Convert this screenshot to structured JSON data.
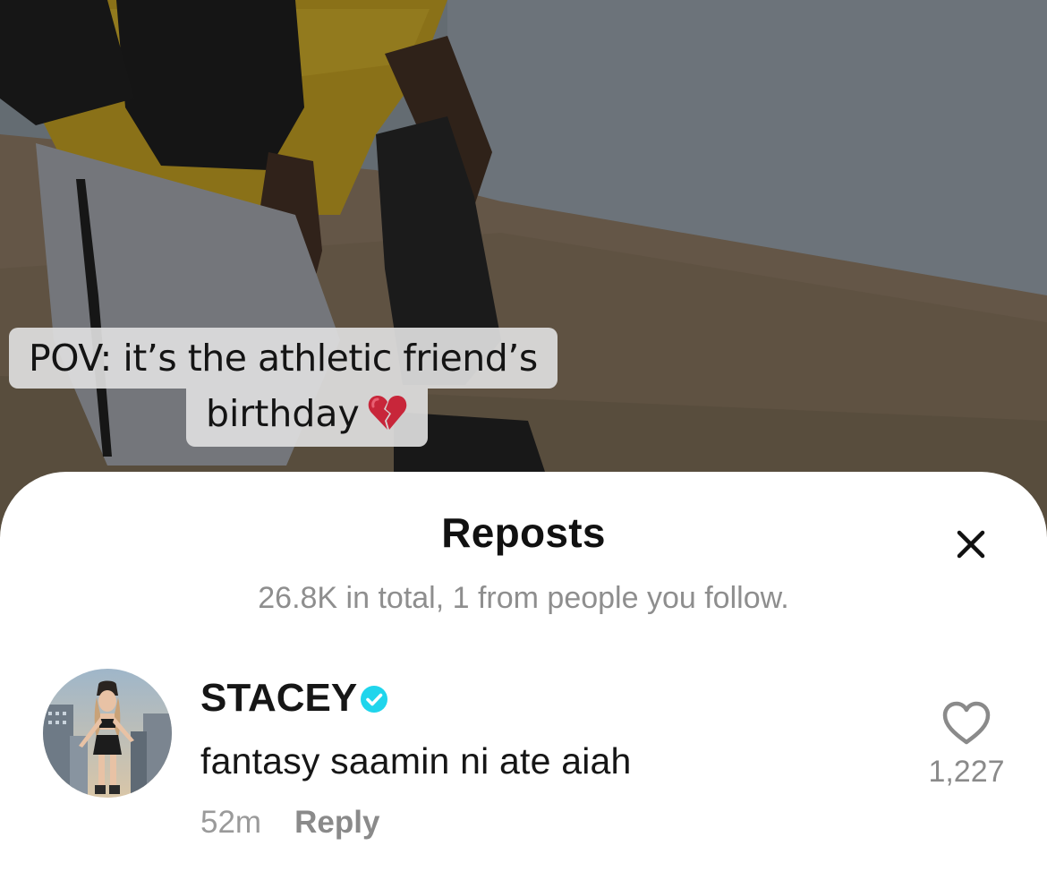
{
  "video": {
    "caption_line1": "POV: it’s the athletic friend’s",
    "caption_line2": "birthday"
  },
  "sheet": {
    "title": "Reposts",
    "subtitle": "26.8K in total, 1 from people you follow."
  },
  "comments": [
    {
      "username": "STACEY",
      "verified": true,
      "text": "fantasy saamin ni ate aiah",
      "time": "52m",
      "reply_label": "Reply",
      "likes": "1,227"
    }
  ],
  "icons": {
    "close": "close-icon",
    "verified": "verified-badge-icon",
    "like": "heart-outline-icon",
    "caption_emoji": "broken-heart-icon"
  },
  "colors": {
    "verified_badge": "#20d5ec",
    "subtitle_text": "#8e8e8e",
    "primary_text": "#161616"
  }
}
